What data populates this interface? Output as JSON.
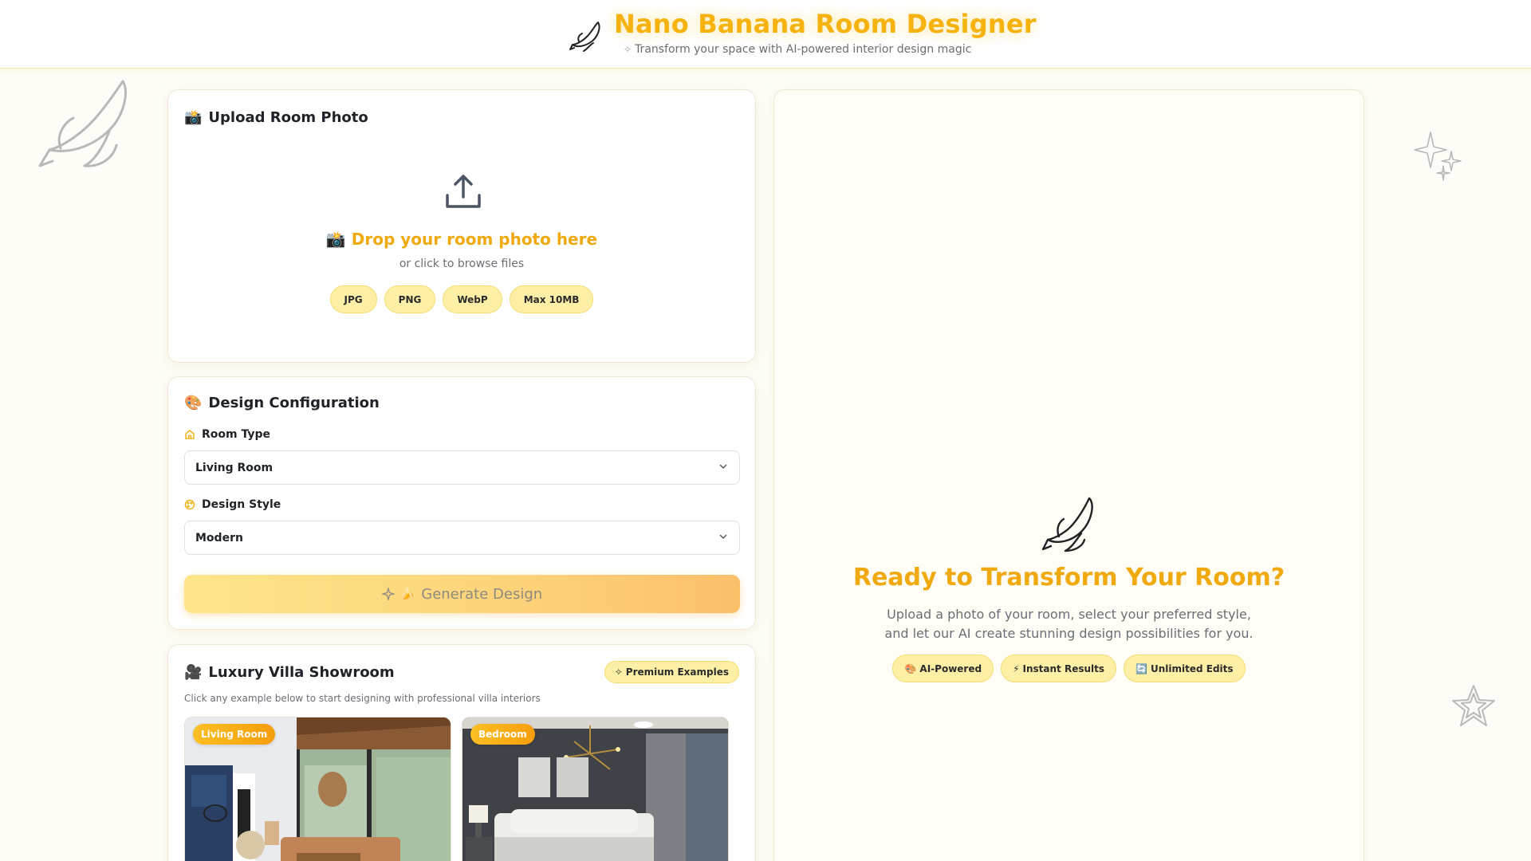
{
  "header": {
    "title": "Nano Banana Room Designer",
    "subtitle": "Transform your space with AI-powered interior design magic",
    "logo_icon": "banana-icon",
    "accent_color": "#f6b20f"
  },
  "upload": {
    "title": "Upload Room Photo",
    "title_icon": "camera-icon",
    "drop_title": "📸 Drop your room photo here",
    "drop_sub": "or click to browse files",
    "formats": [
      "JPG",
      "PNG",
      "WebP",
      "Max 10MB"
    ]
  },
  "config": {
    "title": "Design Configuration",
    "title_icon": "palette-icon",
    "room_type_label": "Room Type",
    "room_type_value": "Living Room",
    "design_style_label": "Design Style",
    "design_style_value": "Modern",
    "generate_label": "Generate Design"
  },
  "showroom": {
    "title": "Luxury Villa Showroom",
    "title_icon": "film-camera-icon",
    "badge": "Premium Examples",
    "subtitle": "Click any example below to start designing with professional villa interiors",
    "examples": [
      {
        "tag": "Living Room"
      },
      {
        "tag": "Bedroom"
      }
    ]
  },
  "preview": {
    "title": "Ready to Transform Your Room?",
    "desc_line1": "Upload a photo of your room, select your preferred style,",
    "desc_line2": "and let our AI create stunning design possibilities for you.",
    "chips": [
      "AI-Powered",
      "Instant Results",
      "Unlimited Edits"
    ]
  }
}
